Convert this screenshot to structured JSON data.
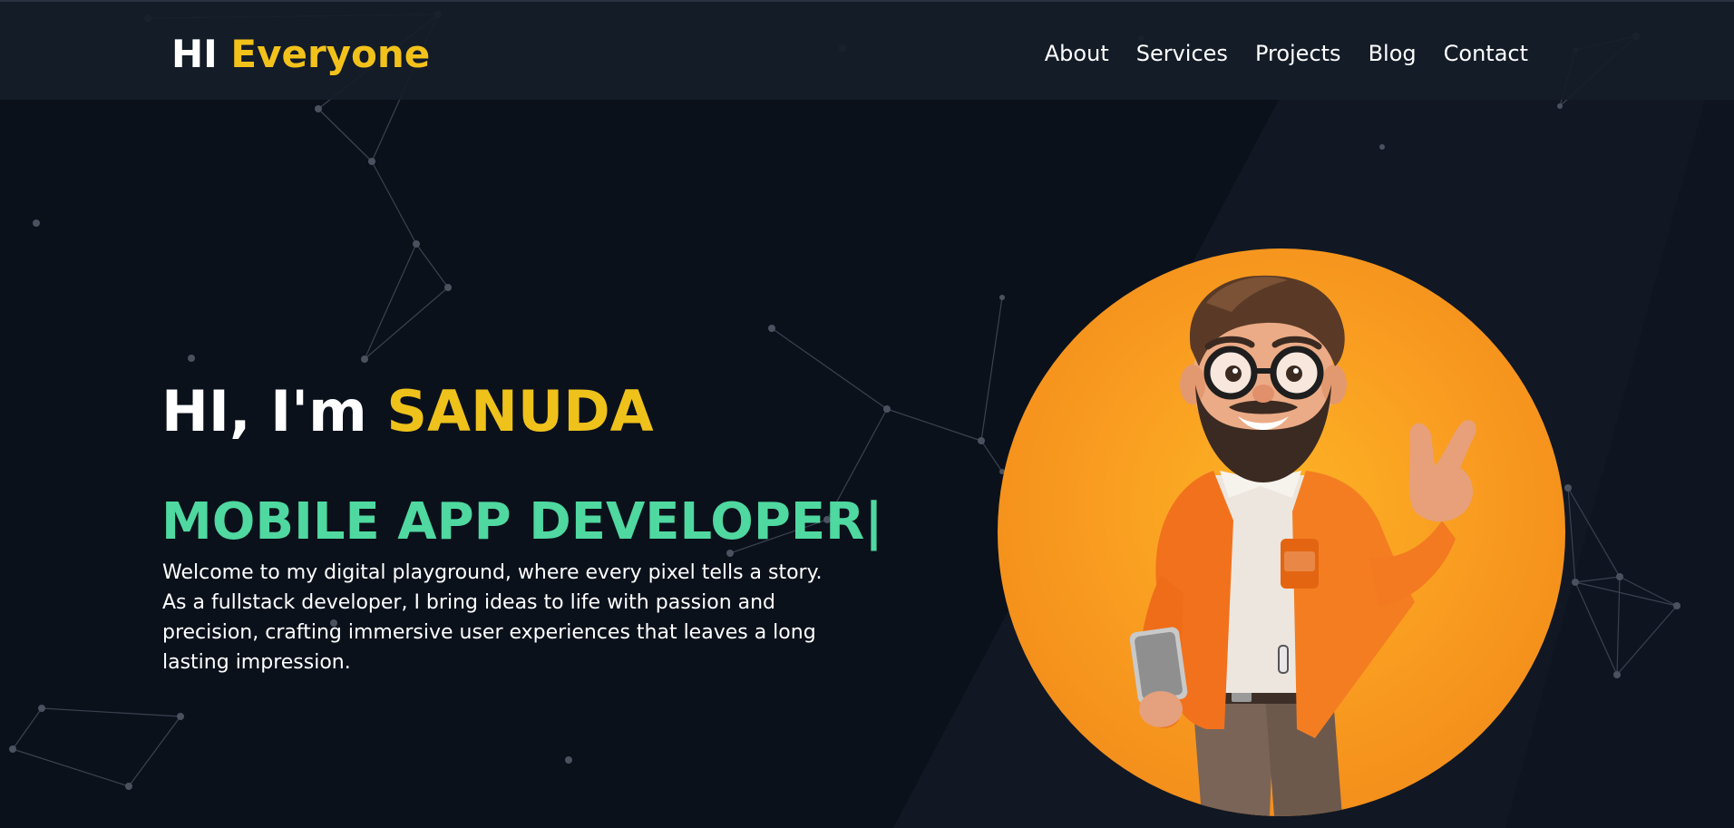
{
  "header": {
    "logo_part1": "HI",
    "logo_part2": "Everyone",
    "nav": [
      "About",
      "Services",
      "Projects",
      "Blog",
      "Contact"
    ]
  },
  "hero": {
    "greeting_prefix": "HI, I'm",
    "name": "SANUDA",
    "role": "MOBILE APP DEVELOPER|",
    "bio": "Welcome to my digital playground, where every pixel tells a story. As a fullstack developer, I bring ideas to life with passion and precision, crafting immersive user experiences that leaves a long lasting impression."
  },
  "colors": {
    "background": "#0b111b",
    "accent_yellow": "#f2c21b",
    "accent_green": "#4fd8a0",
    "avatar_orange": "#f99c20"
  },
  "icons": {
    "avatar": "cartoon-developer-avatar"
  }
}
